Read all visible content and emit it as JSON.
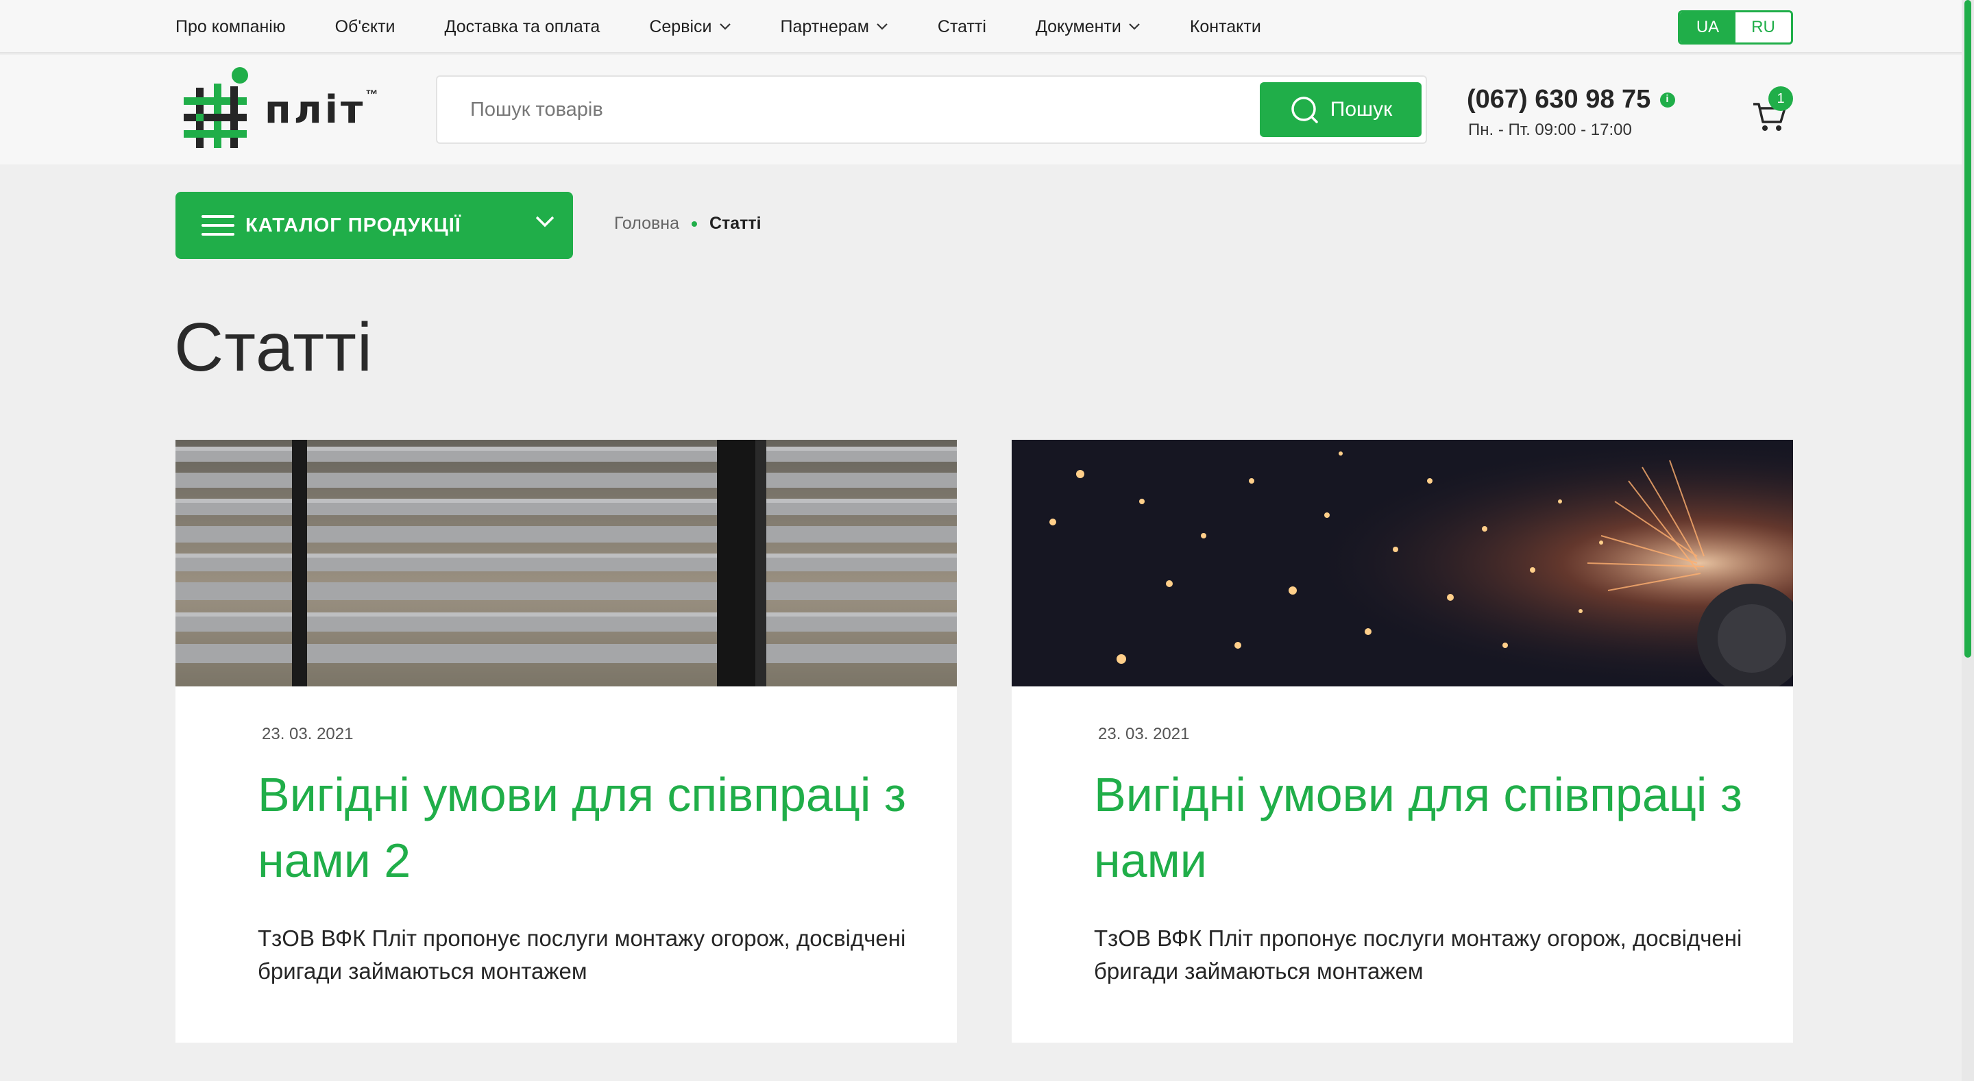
{
  "topnav": {
    "items": [
      {
        "label": "Про компанію",
        "dropdown": false
      },
      {
        "label": "Об'єкти",
        "dropdown": false
      },
      {
        "label": "Доставка та оплата",
        "dropdown": false
      },
      {
        "label": "Сервіси",
        "dropdown": true
      },
      {
        "label": "Партнерам",
        "dropdown": true
      },
      {
        "label": "Статті",
        "dropdown": false
      },
      {
        "label": "Документи",
        "dropdown": true
      },
      {
        "label": "Контакти",
        "dropdown": false
      }
    ],
    "lang": {
      "active": "UA",
      "inactive": "RU"
    }
  },
  "header": {
    "logo_text": "пліт",
    "logo_tm": "™",
    "search_placeholder": "Пошук товарів",
    "search_button": "Пошук",
    "phone": "(067) 630 98 75",
    "hours": "Пн. - Пт. 09:00 - 17:00",
    "cart_count": "1"
  },
  "catalog": {
    "label": "КАТАЛОГ ПРОДУКЦІЇ"
  },
  "breadcrumb": {
    "home": "Головна",
    "current": "Статті"
  },
  "page_title": "Статті",
  "articles": [
    {
      "date": "23. 03. 2021",
      "title": "Вигідні умови для співпраці з нами 2",
      "text": "ТзОВ ВФК Пліт пропонує послуги монтажу огорож, досвідчені бригади займаються монтажем"
    },
    {
      "date": "23. 03. 2021",
      "title": "Вигідні умови для співпраці з нами",
      "text": "ТзОВ ВФК Пліт пропонує послуги монтажу огорож, досвідчені бригади займаються монтажем"
    }
  ],
  "colors": {
    "accent": "#20ae49",
    "background": "#efefef",
    "text": "#222222"
  }
}
